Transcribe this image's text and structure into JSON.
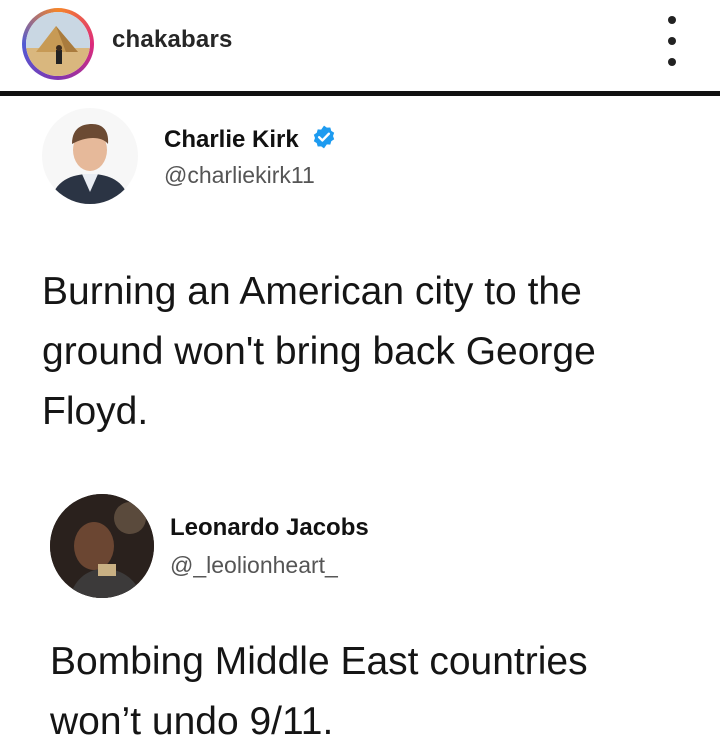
{
  "instagram_header": {
    "username": "chakabars",
    "more_icon": "more-vertical-icon"
  },
  "tweet": {
    "author_name": "Charlie Kirk",
    "author_handle": "@charliekirk11",
    "verified_icon": "verified-badge-icon",
    "text_lines": [
      "Burning an American city to the",
      "ground won't bring back George",
      "Floyd."
    ]
  },
  "reply": {
    "author_name": "Leonardo Jacobs",
    "author_handle": "@_leolionheart_",
    "text_lines": [
      "Bombing Middle East countries",
      "won’t undo 9/11."
    ]
  },
  "colors": {
    "verified_blue": "#1d9bf0",
    "divider": "#111111",
    "handle_gray": "#555555"
  }
}
